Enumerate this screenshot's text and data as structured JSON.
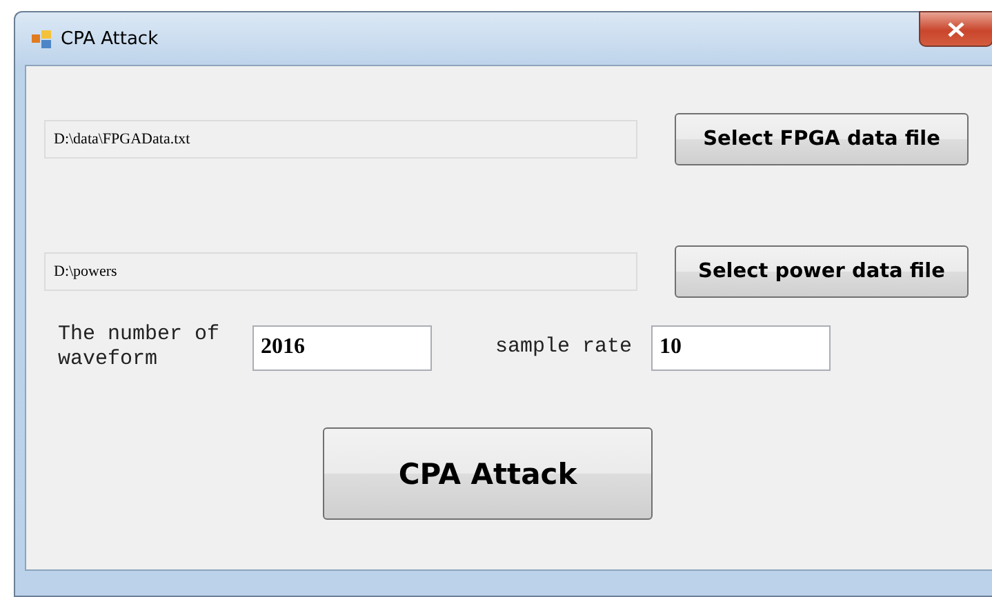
{
  "window": {
    "title": "CPA Attack"
  },
  "file_rows": [
    {
      "path": "D:\\data\\FPGAData.txt",
      "button": "Select FPGA data file"
    },
    {
      "path": "D:\\powers",
      "button": "Select power data file"
    }
  ],
  "waveform_count": {
    "label": "The number of waveform",
    "value": "2016"
  },
  "sample_rate": {
    "label": "sample rate",
    "value": "10"
  },
  "attack_button": "CPA Attack"
}
